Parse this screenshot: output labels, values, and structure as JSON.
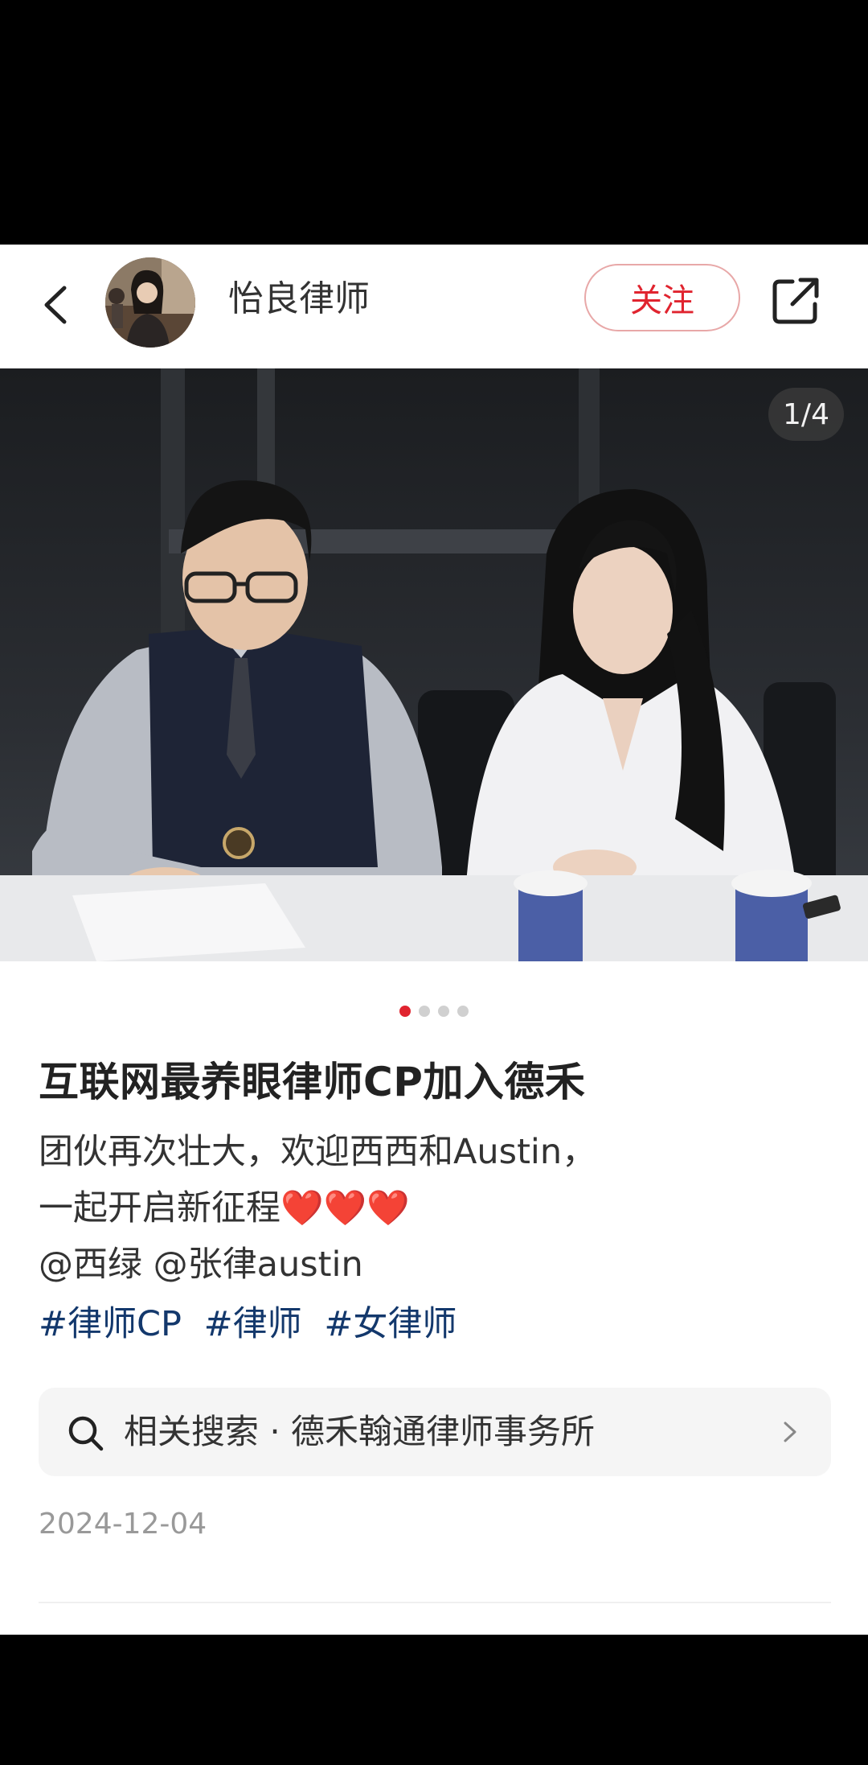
{
  "header": {
    "author_name": "怡良律师",
    "follow_label": "关注"
  },
  "photo": {
    "page_counter": "1/4",
    "current_page": 1,
    "total_pages": 4
  },
  "post": {
    "title": "互联网最养眼律师CP加入德禾",
    "body_line1": "团伙再次壮大，欢迎西西和Austin，",
    "body_line2": "一起开启新征程❤️❤️❤️",
    "mentions": [
      "@西绿",
      "@张律austin"
    ],
    "tags": [
      "#律师CP",
      "#律师",
      "#女律师"
    ],
    "date": "2024-12-04"
  },
  "related_search": {
    "label": "相关搜索 · 德禾翰通律师事务所"
  },
  "icons": {
    "back": "chevron-left-icon",
    "share": "share-icon",
    "search": "search-icon",
    "chevron": "chevron-right-icon"
  },
  "colors": {
    "accent": "#e0242f",
    "tag": "#13386c"
  }
}
